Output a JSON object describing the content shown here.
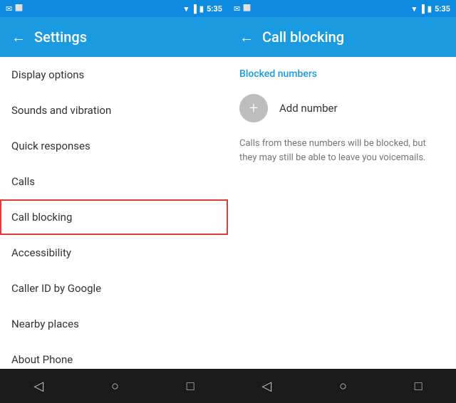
{
  "left_panel": {
    "status_bar": {
      "left_icons": [
        "envelope",
        "image"
      ],
      "right_icons": [
        "wifi",
        "signal",
        "battery"
      ],
      "time": "5:35"
    },
    "toolbar": {
      "back_label": "←",
      "title": "Settings"
    },
    "menu_items": [
      {
        "id": "display-options",
        "label": "Display options",
        "active": false
      },
      {
        "id": "sounds-vibration",
        "label": "Sounds and vibration",
        "active": false
      },
      {
        "id": "quick-responses",
        "label": "Quick responses",
        "active": false
      },
      {
        "id": "calls",
        "label": "Calls",
        "active": false
      },
      {
        "id": "call-blocking",
        "label": "Call blocking",
        "active": true
      },
      {
        "id": "accessibility",
        "label": "Accessibility",
        "active": false
      },
      {
        "id": "caller-id",
        "label": "Caller ID by Google",
        "active": false
      },
      {
        "id": "nearby-places",
        "label": "Nearby places",
        "active": false
      },
      {
        "id": "about-phone",
        "label": "About Phone",
        "active": false
      }
    ],
    "nav": {
      "back": "◁",
      "home": "○",
      "recents": "□"
    }
  },
  "right_panel": {
    "status_bar": {
      "left_icons": [
        "envelope",
        "image"
      ],
      "right_icons": [
        "wifi",
        "signal",
        "battery"
      ],
      "time": "5:35"
    },
    "toolbar": {
      "back_label": "←",
      "title": "Call blocking"
    },
    "section_header": "Blocked numbers",
    "add_number": {
      "icon": "+",
      "label": "Add number"
    },
    "info_text": "Calls from these numbers will be blocked, but they may still be able to leave you voicemails.",
    "nav": {
      "back": "◁",
      "home": "○",
      "recents": "□"
    }
  }
}
